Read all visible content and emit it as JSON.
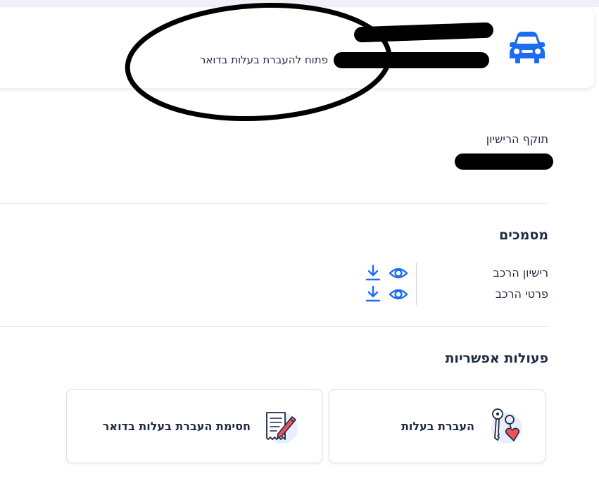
{
  "header": {
    "subtitle": "פתוח להעברת בעלות בדואר",
    "icon": "car-icon",
    "accent_color": "#1a6df2"
  },
  "details": {
    "license_validity_label": "תוקף הרישיון"
  },
  "documents": {
    "title": "מסמכים",
    "items": [
      {
        "label": "רישיון הרכב",
        "view_icon": "eye-icon",
        "download_icon": "download-icon"
      },
      {
        "label": "פרטי הרכב",
        "view_icon": "eye-icon",
        "download_icon": "download-icon"
      }
    ]
  },
  "actions": {
    "title": "פעולות אפשריות",
    "items": [
      {
        "label": "העברת בעלות",
        "icon": "keys-heart-icon"
      },
      {
        "label": "חסימת העברת בעלות בדואר",
        "icon": "signed-document-icon"
      }
    ]
  }
}
